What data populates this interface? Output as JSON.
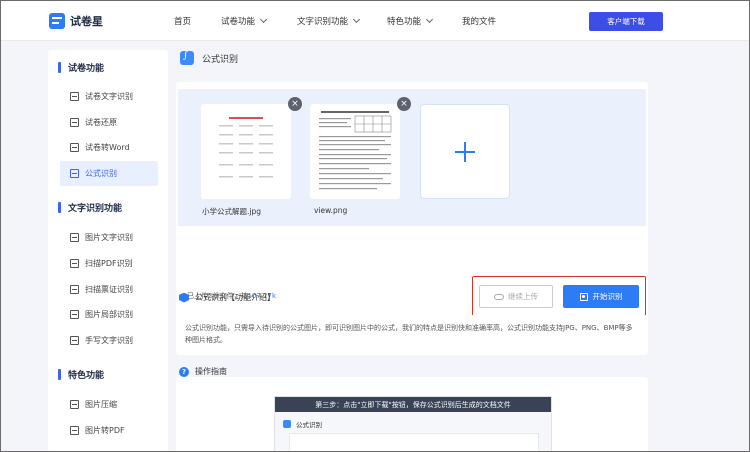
{
  "header": {
    "brand": "试卷星",
    "nav": [
      "首页",
      "试卷功能",
      "文字识别功能",
      "特色功能",
      "我的文件"
    ],
    "download_label": "客户端下载"
  },
  "sidebar": {
    "groups": [
      {
        "title": "试卷功能",
        "items": [
          "试卷文字识别",
          "试卷还原",
          "试卷转Word",
          "公式识别"
        ]
      },
      {
        "title": "文字识别功能",
        "items": [
          "图片文字识别",
          "扫描PDF识别",
          "扫描票证识别",
          "图片局部识别",
          "手写文字识别"
        ]
      },
      {
        "title": "特色功能",
        "items": [
          "图片压缩",
          "图片转PDF"
        ]
      }
    ],
    "active_item": "公式识别"
  },
  "page": {
    "title": "公式识别",
    "files": [
      {
        "name": "小学公式解题.jpg"
      },
      {
        "name": "view.png"
      }
    ],
    "close_symbol": "×",
    "summary_prefix": "已上传",
    "summary_count": "2",
    "summary_mid": "份文件，共",
    "summary_size": "107.17k",
    "continue_label": "继续上传",
    "start_label": "开始识别"
  },
  "intro": {
    "title": "公式识别【功能介绍】",
    "body": "公式识别功能，只需导入待识别的公式图片，即可识别图片中的公式，我们的特点是识别快和准确率高，公式识别功能支持JPG、PNG、BMP等多种图片格式。"
  },
  "guide": {
    "title": "操作指南",
    "help_symbol": "?",
    "banner": "第三步：点击\"立即下载\"按钮，保存公式识别后生成的文档文件",
    "inner_title": "公式识别"
  },
  "colors": {
    "primary": "#2d7cf6",
    "download_button": "#3d4de8",
    "highlight_border": "#d93025",
    "drop_zone": "#eaf1fd"
  }
}
